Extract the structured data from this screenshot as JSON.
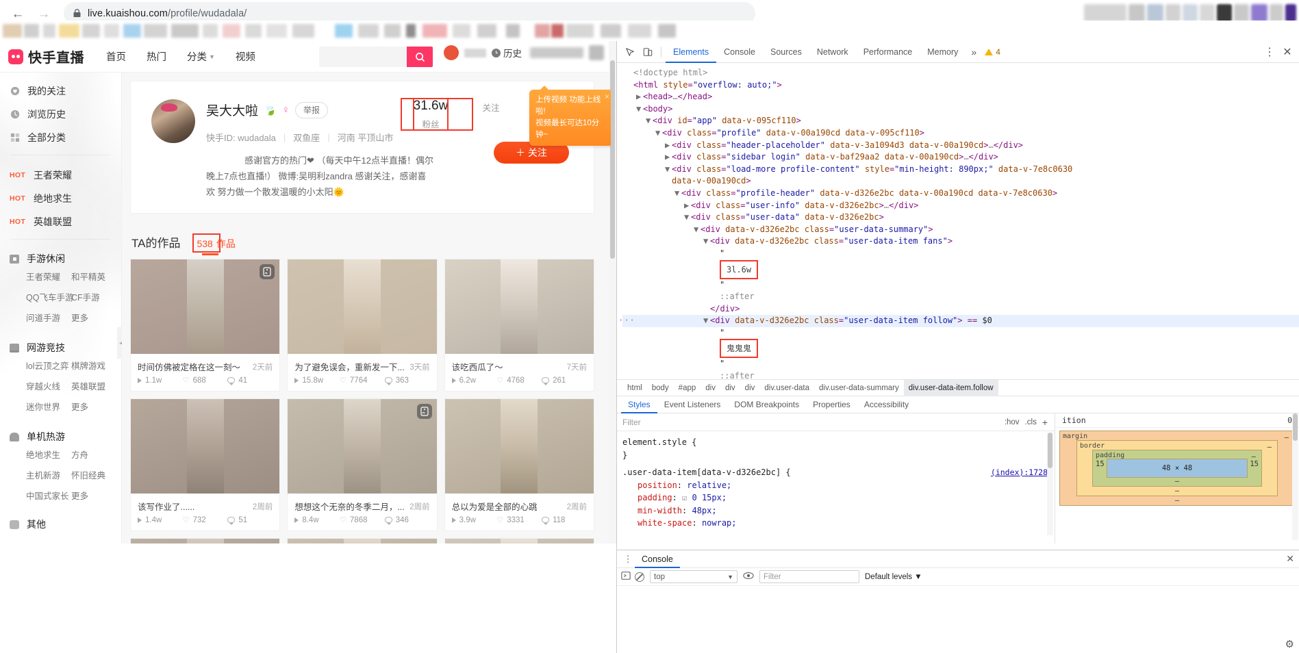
{
  "browser": {
    "url_main": "live.kuaishou.com",
    "url_path": "/profile/wudadala/",
    "back_icon": "back-arrow-icon",
    "forward_icon": "forward-arrow-icon",
    "reload_icon": "reload-icon",
    "lock_icon": "lock-icon"
  },
  "site": {
    "logo_text": "快手直播",
    "nav": [
      {
        "label": "首页"
      },
      {
        "label": "热门"
      },
      {
        "label": "分类"
      },
      {
        "label": "视频"
      }
    ],
    "search_placeholder": "",
    "search_value": "",
    "history_label": "历史"
  },
  "sidebar": {
    "top_items": [
      {
        "label": "我的关注",
        "icon": "heart-icon"
      },
      {
        "label": "浏览历史",
        "icon": "clock-icon"
      },
      {
        "label": "全部分类",
        "icon": "grid-icon"
      }
    ],
    "hot_items": [
      {
        "tag": "HOT",
        "label": "王者荣耀"
      },
      {
        "tag": "HOT",
        "label": "绝地求生"
      },
      {
        "tag": "HOT",
        "label": "英雄联盟"
      }
    ],
    "categories": [
      {
        "title": "手游休闲",
        "icon": "phone-icon",
        "links": [
          "王者荣耀",
          "和平精英",
          "QQ飞车手游",
          "CF手游",
          "问道手游",
          "更多"
        ]
      },
      {
        "title": "网游竞技",
        "icon": "monitor-icon",
        "links": [
          "lol云顶之弈",
          "棋牌游戏",
          "穿越火线",
          "英雄联盟",
          "迷你世界",
          "更多"
        ]
      },
      {
        "title": "单机热游",
        "icon": "console-icon",
        "links": [
          "绝地求生",
          "方舟",
          "主机新游",
          "怀旧经典",
          "中国式家长",
          "更多"
        ]
      }
    ],
    "other_label": "其他",
    "other_icon": "dots-icon"
  },
  "profile": {
    "name": "吴大大啦",
    "name_badge": "leaf-icon",
    "gender_icon": "female-icon",
    "report_label": "举报",
    "meta": {
      "id_label": "快手ID:",
      "id_value": "wudadala",
      "zodiac": "双鱼座",
      "location": "河南 平顶山市"
    },
    "bio_line1": "感谢官方的热门❤    （每天中午12点半直播！偶尔",
    "bio_line2": "晚上7点也直播!）     微博:吴明利zandra  感谢关注，感谢喜",
    "bio_line3": "欢  努力做一个散发温暖的小太阳🌞",
    "stats": [
      {
        "num": "31.6w",
        "label": "粉丝",
        "highlighted": true
      },
      {
        "num": "",
        "label": "关注",
        "highlighted": true
      },
      {
        "num": "",
        "label": "作品",
        "highlighted": false
      }
    ],
    "follow_button": "＋ 关注",
    "tooltip_line1": "上传视频 功能上线啦!",
    "tooltip_line2": "视频最长可达10分钟~",
    "tooltip_close": "×"
  },
  "works": {
    "section_title": "TA的作品",
    "tab_count": "538",
    "tab_label": "作品",
    "items": [
      {
        "title": "时间仿佛被定格在这一刻～",
        "ago": "2天前",
        "plays": "1.1w",
        "likes": "688",
        "comments": "41",
        "multi": true,
        "bg": "linear-gradient(160deg,#b8a79c,#a8968c)",
        "center": "linear-gradient(180deg,#d6cfc6,#bfb6a8,#a89b8b)"
      },
      {
        "title": "为了避免误会，重新发一下...",
        "ago": "3天前",
        "plays": "15.8w",
        "likes": "7764",
        "comments": "363",
        "multi": false,
        "bg": "linear-gradient(160deg,#cfc3b0,#c6b8a4)",
        "center": "linear-gradient(180deg,#e8dfd2,#d6c9b6,#c2b29c)"
      },
      {
        "title": "该吃西瓜了～",
        "ago": "7天前",
        "plays": "6.2w",
        "likes": "4768",
        "comments": "261",
        "multi": false,
        "bg": "linear-gradient(160deg,#d9d2c4,#b9b2a6)",
        "center": "linear-gradient(180deg,#efe8e0,#d3cabf,#b0a69a)"
      },
      {
        "title": "该写作业了......",
        "ago": "2周前",
        "plays": "1.4w",
        "likes": "732",
        "comments": "51",
        "multi": false,
        "bg": "linear-gradient(160deg,#b6a79b,#9d8e84)",
        "center": "linear-gradient(180deg,#ccc1b6,#b0a295,#8f8377)"
      },
      {
        "title": "想想这个无奈的冬季二月，...",
        "ago": "2周前",
        "plays": "8.4w",
        "likes": "7868",
        "comments": "346",
        "multi": true,
        "bg": "linear-gradient(160deg,#c5bcae,#aca394)",
        "center": "linear-gradient(180deg,#ded6ca,#c0b5a6,#9d9385)"
      },
      {
        "title": "总以为爱是全部的心跳",
        "ago": "2周前",
        "plays": "3.9w",
        "likes": "3331",
        "comments": "118",
        "multi": false,
        "bg": "linear-gradient(160deg,#cdc3b2,#b2a795)",
        "center": "linear-gradient(180deg,#e3dacb,#c8bca8,#a1947f)"
      },
      {
        "title": "",
        "ago": "",
        "plays": "",
        "likes": "",
        "comments": "",
        "multi": true,
        "bg": "linear-gradient(160deg,#bcb0a3,#a1968a)",
        "center": "linear-gradient(180deg,#d2c8bc,#b3a89a,#908678)"
      },
      {
        "title": "",
        "ago": "",
        "plays": "",
        "likes": "",
        "comments": "",
        "multi": false,
        "bg": "linear-gradient(160deg,#cbc0b0,#b0a593)",
        "center": "linear-gradient(180deg,#e0d7c9,#c4b9a6,#9e937f)"
      },
      {
        "title": "",
        "ago": "",
        "plays": "",
        "likes": "",
        "comments": "",
        "multi": false,
        "bg": "linear-gradient(160deg,#d0c8ba,#b5ab9c)",
        "center": "linear-gradient(180deg,#e6dfd3,#cabfae,#a69a88)"
      }
    ]
  },
  "devtools": {
    "tabs": [
      {
        "label": "Elements",
        "active": true
      },
      {
        "label": "Console",
        "active": false
      },
      {
        "label": "Sources",
        "active": false
      },
      {
        "label": "Network",
        "active": false
      },
      {
        "label": "Performance",
        "active": false
      },
      {
        "label": "Memory",
        "active": false
      }
    ],
    "more_icon": "chevron-double-right-icon",
    "warning_count": "4",
    "settings_icon": "kebab-menu-icon",
    "close_icon": "close-icon",
    "inspect_icon": "inspect-icon",
    "device_icon": "device-toolbar-icon",
    "tree": [
      {
        "indent": 0,
        "arrow": "",
        "html": "<span class=\"cm\">&lt;!doctype html&gt;</span>"
      },
      {
        "indent": 0,
        "arrow": "",
        "html": "<span class=\"tag\">&lt;html</span> <span class=\"pt\">style</span>=<span class=\"pv\">\"overflow: auto;\"</span><span class=\"tag\">&gt;</span>"
      },
      {
        "indent": 1,
        "arrow": "▶",
        "html": "<span class=\"tag\">&lt;head&gt;</span><span class=\"cm\">…</span><span class=\"tag\">&lt;/head&gt;</span>"
      },
      {
        "indent": 1,
        "arrow": "▼",
        "html": "<span class=\"tag\">&lt;body&gt;</span>"
      },
      {
        "indent": 2,
        "arrow": "▼",
        "html": "<span class=\"tag\">&lt;div</span> <span class=\"pt\">id</span>=<span class=\"pv\">\"app\"</span> <span class=\"pt\">data-v-095cf110</span><span class=\"tag\">&gt;</span>"
      },
      {
        "indent": 3,
        "arrow": "▼",
        "html": "<span class=\"tag\">&lt;div</span> <span class=\"pt\">class</span>=<span class=\"pv\">\"profile\"</span> <span class=\"pt\">data-v-00a190cd</span> <span class=\"pt\">data-v-095cf110</span><span class=\"tag\">&gt;</span>"
      },
      {
        "indent": 4,
        "arrow": "▶",
        "html": "<span class=\"tag\">&lt;div</span> <span class=\"pt\">class</span>=<span class=\"pv\">\"header-placeholder\"</span> <span class=\"pt\">data-v-3a1094d3</span> <span class=\"pt\">data-v-00a190cd</span><span class=\"tag\">&gt;</span><span class=\"cm\">…</span><span class=\"tag\">&lt;/div&gt;</span>"
      },
      {
        "indent": 4,
        "arrow": "▶",
        "html": "<span class=\"tag\">&lt;div</span> <span class=\"pt\">class</span>=<span class=\"pv\">\"sidebar login\"</span> <span class=\"pt\">data-v-baf29aa2</span> <span class=\"pt\">data-v-00a190cd</span><span class=\"tag\">&gt;</span><span class=\"cm\">…</span><span class=\"tag\">&lt;/div&gt;</span>"
      },
      {
        "indent": 4,
        "arrow": "▼",
        "html": "<span class=\"tag\">&lt;div</span> <span class=\"pt\">class</span>=<span class=\"pv\">\"load-more profile-content\"</span> <span class=\"pt\">style</span>=<span class=\"pv\">\"min-height: 890px;\"</span> <span class=\"pt\">data-v-7e8c0630</span>"
      },
      {
        "indent": 4,
        "arrow": "",
        "html": "<span class=\"pt\">data-v-00a190cd</span><span class=\"tag\">&gt;</span>"
      },
      {
        "indent": 5,
        "arrow": "▼",
        "html": "<span class=\"tag\">&lt;div</span> <span class=\"pt\">class</span>=<span class=\"pv\">\"profile-header\"</span> <span class=\"pt\">data-v-d326e2bc</span> <span class=\"pt\">data-v-00a190cd</span> <span class=\"pt\">data-v-7e8c0630</span><span class=\"tag\">&gt;</span>"
      },
      {
        "indent": 6,
        "arrow": "▶",
        "html": "<span class=\"tag\">&lt;div</span> <span class=\"pt\">class</span>=<span class=\"pv\">\"user-info\"</span> <span class=\"pt\">data-v-d326e2bc</span><span class=\"tag\">&gt;</span><span class=\"cm\">…</span><span class=\"tag\">&lt;/div&gt;</span>"
      },
      {
        "indent": 6,
        "arrow": "▼",
        "html": "<span class=\"tag\">&lt;div</span> <span class=\"pt\">class</span>=<span class=\"pv\">\"user-data\"</span> <span class=\"pt\">data-v-d326e2bc</span><span class=\"tag\">&gt;</span>"
      },
      {
        "indent": 7,
        "arrow": "▼",
        "html": "<span class=\"tag\">&lt;div</span> <span class=\"pt\">data-v-d326e2bc</span> <span class=\"pt\">class</span>=<span class=\"pv\">\"user-data-summary\"</span><span class=\"tag\">&gt;</span>"
      },
      {
        "indent": 8,
        "arrow": "▼",
        "html": "<span class=\"tag\">&lt;div</span> <span class=\"pt\">data-v-d326e2bc</span> <span class=\"pt\">class</span>=<span class=\"pv\">\"user-data-item fans\"</span><span class=\"tag\">&gt;</span>"
      },
      {
        "indent": 9,
        "arrow": "",
        "html": "<span class=\"txt\">\"</span>"
      },
      {
        "indent": 9,
        "arrow": "",
        "html": "<span class=\"redbox\">3l.6w</span>"
      },
      {
        "indent": 9,
        "arrow": "",
        "html": "<span class=\"txt\">\"</span>"
      },
      {
        "indent": 9,
        "arrow": "",
        "html": "<span class=\"cm\">::after</span>"
      },
      {
        "indent": 8,
        "arrow": "",
        "html": "<span class=\"tag\">&lt;/div&gt;</span>"
      },
      {
        "indent": 8,
        "arrow": "▼",
        "html": "<span class=\"tag\">&lt;div</span> <span class=\"pt\">data-v-d326e2bc</span> <span class=\"pt\">class</span>=<span class=\"pv\">\"user-data-item follow\"</span><span class=\"tag\">&gt;</span> == <span class=\"dollar\">$0</span>",
        "selected": true
      },
      {
        "indent": 9,
        "arrow": "",
        "html": "<span class=\"txt\">\"</span>"
      },
      {
        "indent": 9,
        "arrow": "",
        "html": "<span class=\"redbox\">鬼鬼鬼</span>"
      },
      {
        "indent": 9,
        "arrow": "",
        "html": "<span class=\"txt\">\"</span>"
      },
      {
        "indent": 9,
        "arrow": "",
        "html": "<span class=\"cm\">::after</span>"
      },
      {
        "indent": 8,
        "arrow": "",
        "html": "<span class=\"tag\">&lt;/div&gt;</span>"
      }
    ],
    "breadcrumbs": [
      "html",
      "body",
      "#app",
      "div",
      "div",
      "div",
      "div.user-data",
      "div.user-data-summary",
      "div.user-data-item.follow"
    ],
    "style_tabs": [
      {
        "label": "Styles",
        "active": true
      },
      {
        "label": "Event Listeners",
        "active": false
      },
      {
        "label": "DOM Breakpoints",
        "active": false
      },
      {
        "label": "Properties",
        "active": false
      },
      {
        "label": "Accessibility",
        "active": false
      }
    ],
    "filter_placeholder": "Filter",
    "hov_label": ":hov",
    "cls_label": ".cls",
    "plus_label": "+",
    "css_rules": [
      {
        "selector": "element.style {",
        "source": "",
        "decls": []
      },
      {
        "selector": "}",
        "source": "",
        "decls": []
      },
      {
        "selector": ".user-data-item[data-v-d326e2bc] {",
        "source": "(index):1728",
        "decls": [
          {
            "prop": "position",
            "val": "relative;"
          },
          {
            "prop": "padding",
            "val": "0 15px;",
            "checkbox": true
          },
          {
            "prop": "min-width",
            "val": "48px;"
          },
          {
            "prop": "white-space",
            "val": "nowrap;"
          }
        ]
      }
    ],
    "computed": {
      "position_label": "ition",
      "position_value": "0",
      "margin_label": "margin",
      "margin_value": "–",
      "border_label": "border",
      "border_value": "–",
      "padding_label": "padding",
      "padding_value": "–",
      "content_size": "48 × 48",
      "pad_left": "15",
      "pad_right": "15",
      "dash": "–"
    },
    "console": {
      "tab_label": "Console",
      "context": "top",
      "filter_placeholder": "Filter",
      "levels": "Default levels ▼",
      "close_icon": "close-icon",
      "settings_icon": "gear-icon",
      "clear_icon": "clear-console-icon",
      "eye_icon": "eye-icon",
      "execute_icon": "execute-icon"
    }
  }
}
